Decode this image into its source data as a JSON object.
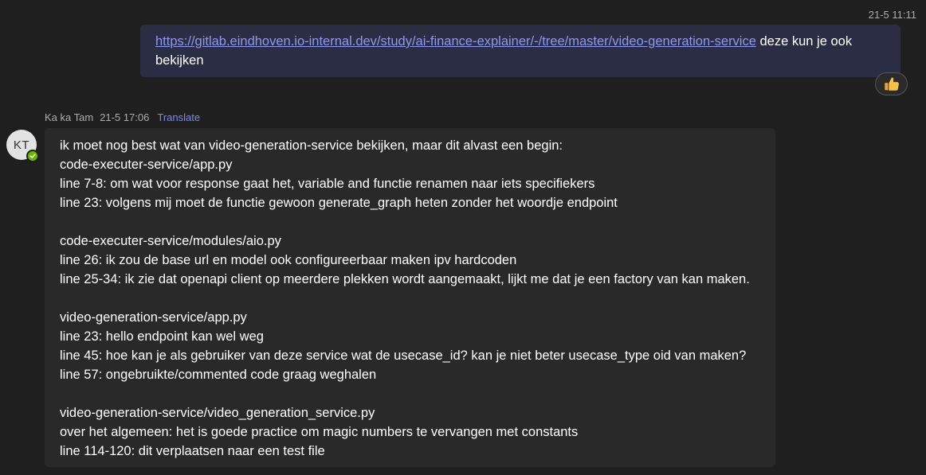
{
  "sent_message": {
    "timestamp": "21-5 11:11",
    "link": "https://gitlab.eindhoven.io-internal.dev/study/ai-finance-explainer/-/tree/master/video-generation-service",
    "text_after_link": " deze kun je ook",
    "text_line2": "bekijken",
    "reaction_icon": "thumbs-up-icon"
  },
  "received_message": {
    "sender": "Ka ka Tam",
    "timestamp": "21-5 17:06",
    "translate_label": "Translate",
    "avatar_initials": "KT",
    "presence_color": "#6bb700",
    "lines": [
      "ik moet nog best wat van video-generation-service bekijken, maar dit alvast een begin:",
      "code-executer-service/app.py",
      "line 7-8: om wat voor response gaat het, variable and functie renamen naar iets specifiekers",
      "line 23: volgens mij moet de functie gewoon generate_graph heten zonder het woordje endpoint",
      "",
      "code-executer-service/modules/aio.py",
      "line 26: ik zou de base url en model ook configureerbaar maken ipv hardcoden",
      "line 25-34: ik zie dat openapi client op meerdere plekken wordt aangemaakt, lijkt me dat je een factory van kan maken.",
      "",
      "video-generation-service/app.py",
      "line 23: hello endpoint kan wel weg",
      "line 45: hoe kan je als gebruiker van deze service wat de usecase_id? kan je niet beter usecase_type oid van maken?",
      "line 57: ongebruikte/commented code graag weghalen",
      "",
      "video-generation-service/video_generation_service.py",
      "over het algemeen: het is goede practice om magic numbers te vervangen met constants",
      "line 114-120: dit verplaatsen naar een test file"
    ]
  },
  "colors": {
    "background": "#1f1f1f",
    "sent_bubble": "#2b2d45",
    "received_bubble": "#292929",
    "link": "#8e98ec",
    "translate": "#7f85f5"
  }
}
